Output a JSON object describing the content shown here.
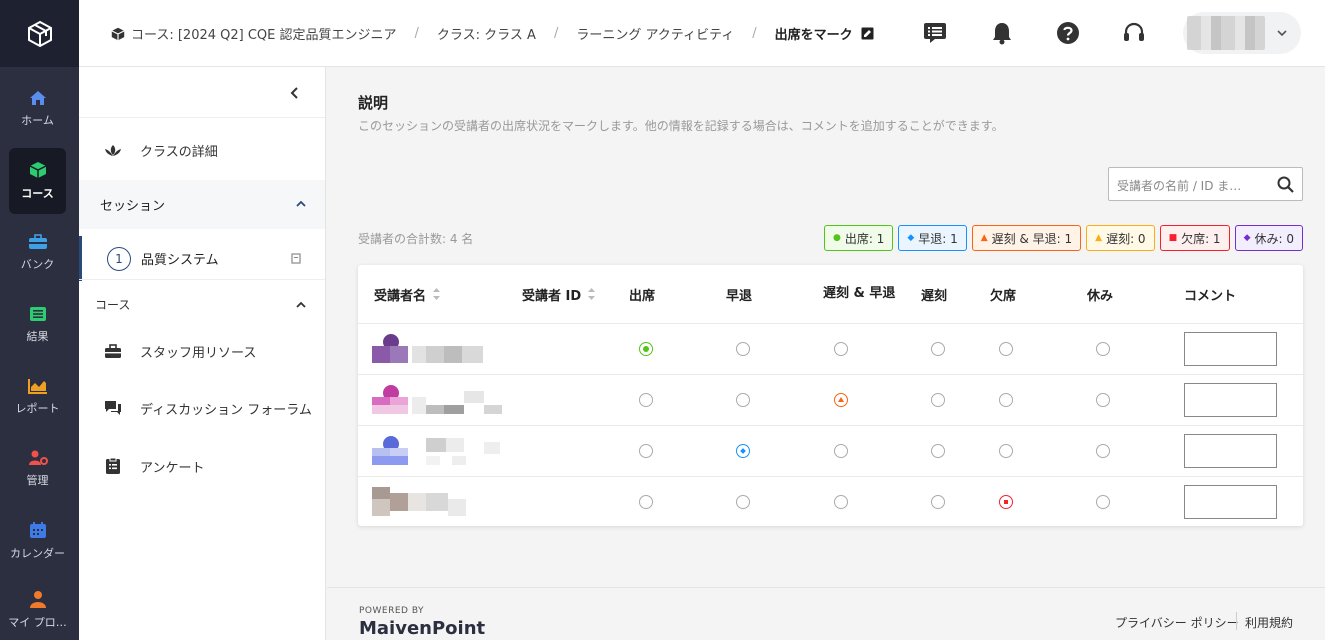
{
  "nav": {
    "items": [
      {
        "label": "ホーム",
        "icon": "home-icon"
      },
      {
        "label": "コース",
        "icon": "cube-icon"
      },
      {
        "label": "バンク",
        "icon": "toolbox-icon"
      },
      {
        "label": "結果",
        "icon": "list-icon"
      },
      {
        "label": "レポート",
        "icon": "chart-icon"
      },
      {
        "label": "管理",
        "icon": "user-gear-icon"
      },
      {
        "label": "カレンダー",
        "icon": "calendar-icon"
      },
      {
        "label": "マイ プロ…",
        "icon": "person-icon"
      }
    ]
  },
  "header": {
    "crumb1": "コース: [2024 Q2] CQE 認定品質エンジニア",
    "crumb2": "クラス: クラス A",
    "crumb3": "ラーニング アクティビティ",
    "crumb4": "出席をマーク"
  },
  "side": {
    "class_details": "クラスの詳細",
    "session_header": "セッション",
    "session_item_num": "1",
    "session_item": "品質システム",
    "course_header": "コース",
    "staff_resources": "スタッフ用リソース",
    "discussion_forum": "ディスカッション フォーラム",
    "survey": "アンケート"
  },
  "main": {
    "desc_title": "説明",
    "desc_text": "このセッションの受講者の出席状況をマークします。他の情報を記録する場合は、コメントを追加することができます。",
    "search_placeholder": "受講者の名前 / ID ま…",
    "total": "受講者の合計数: 4 名",
    "badges": [
      {
        "label": "出席: 1",
        "color": "#52c41a",
        "mark": "●"
      },
      {
        "label": "早退: 1",
        "color": "#1890ff",
        "mark": "◆"
      },
      {
        "label": "遅刻 & 早退: 1",
        "color": "#fa6414",
        "mark": "▲"
      },
      {
        "label": "遅刻: 0",
        "color": "#faad14",
        "mark": "▲"
      },
      {
        "label": "欠席: 1",
        "color": "#f5222d",
        "mark": "■"
      },
      {
        "label": "休み: 0",
        "color": "#722ed1",
        "mark": "◆"
      }
    ],
    "columns": {
      "name": "受講者名",
      "id": "受講者 ID",
      "present": "出席",
      "leave_early": "早退",
      "late_leave": "遅刻 & 早退",
      "late": "遅刻",
      "absent": "欠席",
      "excused": "休み",
      "comment": "コメント"
    },
    "rows": [
      {
        "status": "present"
      },
      {
        "status": "late_leave"
      },
      {
        "status": "leave_early"
      },
      {
        "status": "absent"
      }
    ]
  },
  "footer": {
    "powered_by": "POWERED BY",
    "brand": "MaivenPoint",
    "privacy": "プライバシー ポリシー",
    "terms": "利用規約"
  }
}
